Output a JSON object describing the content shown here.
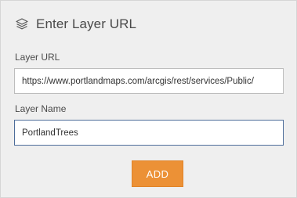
{
  "header": {
    "icon": "layers-icon",
    "title": "Enter Layer URL"
  },
  "form": {
    "url_label": "Layer URL",
    "url_value": "https://www.portlandmaps.com/arcgis/rest/services/Public/",
    "name_label": "Layer Name",
    "name_value": "PortlandTrees"
  },
  "actions": {
    "add_label": "ADD",
    "add_color": "#ec9136"
  }
}
